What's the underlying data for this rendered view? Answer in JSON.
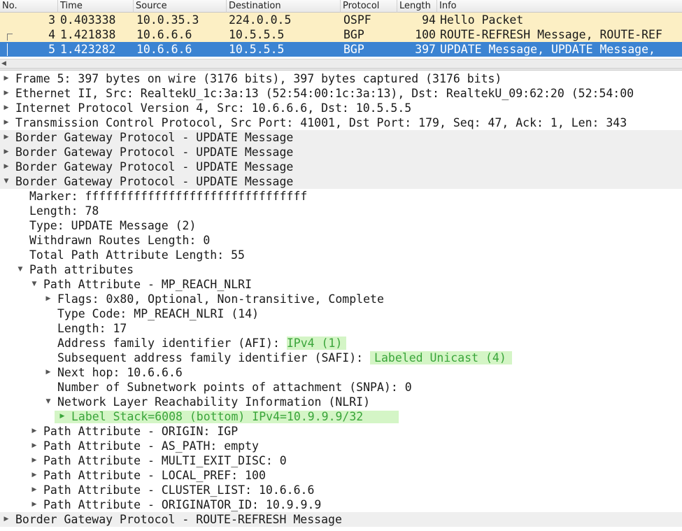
{
  "packet_list": {
    "columns": [
      "No.",
      "Time",
      "Source",
      "Destination",
      "Protocol",
      "Length",
      "Info"
    ],
    "rows": [
      {
        "no": "3",
        "time": "0.403338",
        "source": "10.0.35.3",
        "destination": "224.0.0.5",
        "protocol": "OSPF",
        "length": "94",
        "info": "Hello Packet"
      },
      {
        "no": "4",
        "time": "1.421838",
        "source": "10.6.6.6",
        "destination": "10.5.5.5",
        "protocol": "BGP",
        "length": "100",
        "info": "ROUTE-REFRESH Message, ROUTE-REF"
      },
      {
        "no": "5",
        "time": "1.423282",
        "source": "10.6.6.6",
        "destination": "10.5.5.5",
        "protocol": "BGP",
        "length": "397",
        "info": "UPDATE Message, UPDATE Message,"
      }
    ],
    "row_colors": {
      "highlight": "#fcefc4",
      "selected": "#3b83d2"
    }
  },
  "details": {
    "frame": "Frame 5: 397 bytes on wire (3176 bits), 397 bytes captured (3176 bits)",
    "ethernet": "Ethernet II, Src: RealtekU_1c:3a:13 (52:54:00:1c:3a:13), Dst: RealtekU_09:62:20 (52:54:00",
    "ip": "Internet Protocol Version 4, Src: 10.6.6.6, Dst: 10.5.5.5",
    "tcp": "Transmission Control Protocol, Src Port: 41001, Dst Port: 179, Seq: 47, Ack: 1, Len: 343",
    "bgp_update_1": "Border Gateway Protocol - UPDATE Message",
    "bgp_update_2": "Border Gateway Protocol - UPDATE Message",
    "bgp_update_3": "Border Gateway Protocol - UPDATE Message",
    "bgp_update_4": "Border Gateway Protocol - UPDATE Message",
    "marker": "Marker: ffffffffffffffffffffffffffffffff",
    "length": "Length: 78",
    "type": "Type: UPDATE Message (2)",
    "withdrawn": "Withdrawn Routes Length: 0",
    "total_path_attr_len": "Total Path Attribute Length: 55",
    "path_attributes": "Path attributes",
    "pa_mp_reach": "Path Attribute - MP_REACH_NLRI",
    "flags": "Flags: 0x80, Optional, Non-transitive, Complete",
    "type_code": "Type Code: MP_REACH_NLRI (14)",
    "pa_length": "Length: 17",
    "afi_label": "Address family identifier (AFI): ",
    "afi_value": "IPv4 (1)",
    "safi_label": "Subsequent address family identifier (SAFI): ",
    "safi_value": "Labeled Unicast (4)",
    "next_hop": "Next hop: 10.6.6.6",
    "snpa": "Number of Subnetwork points of attachment (SNPA): 0",
    "nlri": "Network Layer Reachability Information (NLRI)",
    "label_stack": "Label Stack=6008 (bottom)",
    "label_ipv4": "IPv4=10.9.9.9/32",
    "pa_origin": "Path Attribute - ORIGIN: IGP",
    "pa_as_path": "Path Attribute - AS_PATH: empty",
    "pa_med": "Path Attribute - MULTI_EXIT_DISC: 0",
    "pa_local_pref": "Path Attribute - LOCAL_PREF: 100",
    "pa_cluster_list": "Path Attribute - CLUSTER_LIST: 10.6.6.6",
    "pa_originator": "Path Attribute - ORIGINATOR_ID: 10.9.9.9",
    "bgp_route_refresh": "Border Gateway Protocol - ROUTE-REFRESH Message"
  },
  "icons": {
    "collapsed": "triangle-right-icon",
    "expanded": "triangle-down-icon",
    "highlight_color": "#d4f5c6",
    "highlight_text_color": "#3aa53a"
  }
}
